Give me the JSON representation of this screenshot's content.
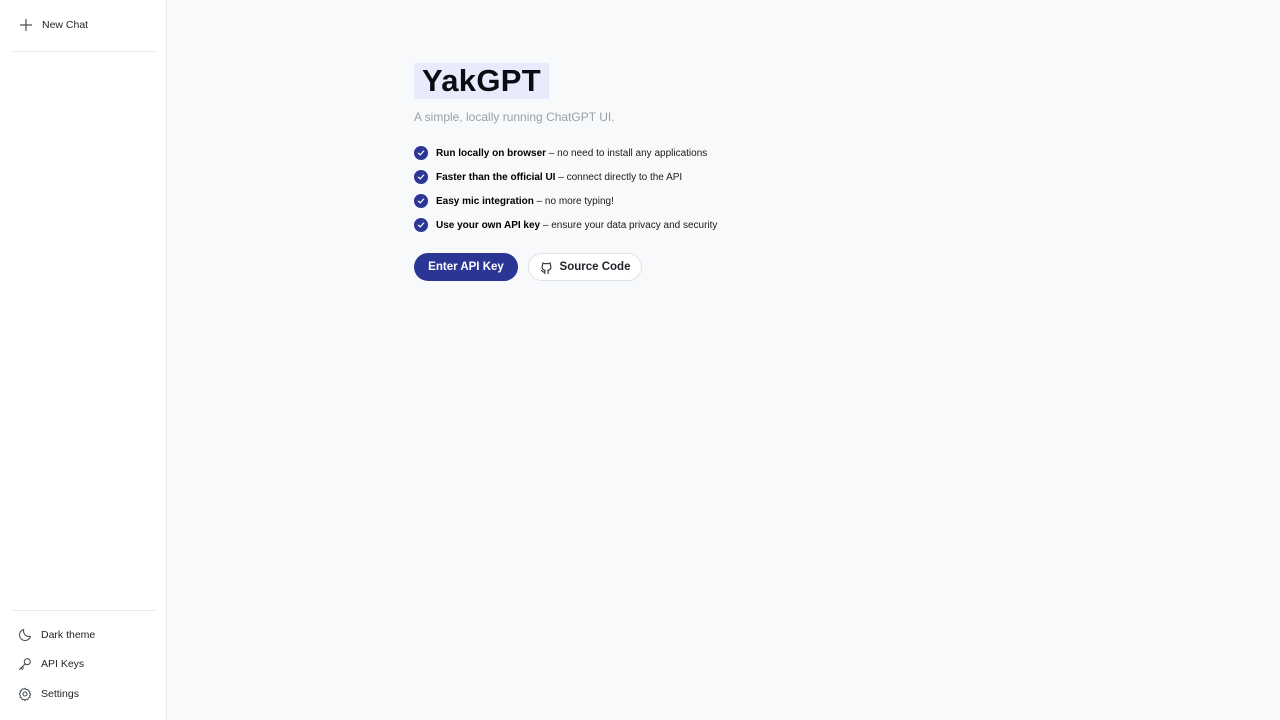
{
  "sidebar": {
    "new_chat": {
      "label": "New Chat",
      "icon": "plus-icon"
    },
    "footer_items": [
      {
        "label": "Dark theme",
        "icon": "moon-icon"
      },
      {
        "label": "API Keys",
        "icon": "key-icon"
      },
      {
        "label": "Settings",
        "icon": "gear-icon"
      }
    ]
  },
  "main": {
    "title": "YakGPT",
    "subtitle": "A simple, locally running ChatGPT UI.",
    "features": [
      {
        "bold": "Run locally on browser",
        "rest": " – no need to install any applications"
      },
      {
        "bold": "Faster than the official UI",
        "rest": " – connect directly to the API"
      },
      {
        "bold": "Easy mic integration",
        "rest": " – no more typing!"
      },
      {
        "bold": "Use your own API key",
        "rest": " – ensure your data privacy and security"
      }
    ],
    "buttons": {
      "primary": "Enter API Key",
      "secondary": "Source Code",
      "secondary_icon": "github-icon"
    }
  },
  "colors": {
    "accent": "#2b3594",
    "title_highlight": "#e7ebfb",
    "background": "#f8f9fa"
  }
}
